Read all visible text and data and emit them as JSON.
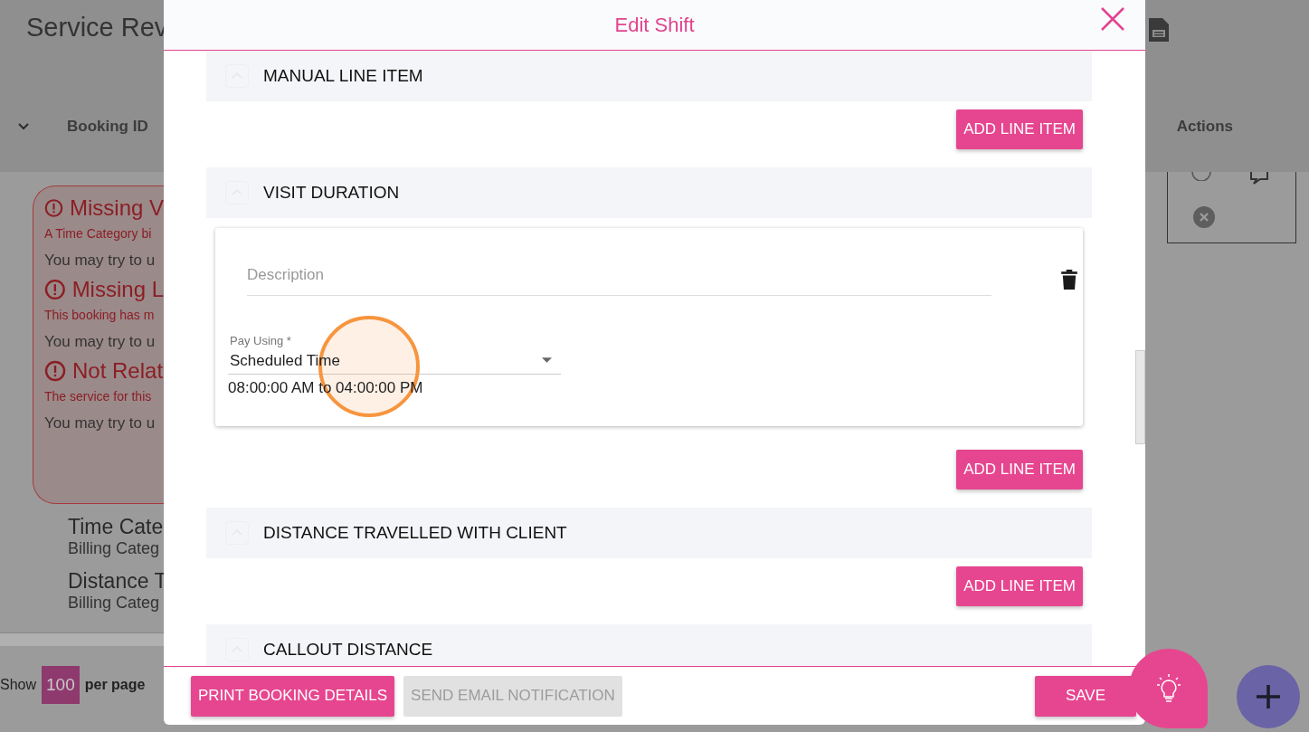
{
  "page": {
    "title": "Service Rev",
    "columns": [
      "Booking ID",
      "Actions"
    ],
    "alerts": [
      {
        "title": "Missing V",
        "detail": "A Time Category bi",
        "hint": "You may try to u"
      },
      {
        "title": "Missing L",
        "detail": "This booking has m",
        "hint": "You may try to u"
      },
      {
        "title": "Not Relat",
        "detail": "The service for this",
        "hint": "You may try to u"
      }
    ],
    "line_items": [
      {
        "name": "Time Cate",
        "category": "Billing Categ"
      },
      {
        "name": "Distance T",
        "category": "Billing Categ"
      }
    ],
    "pagination": {
      "show": "Show",
      "page_size": "100",
      "per_page": "per page"
    }
  },
  "modal": {
    "title": "Edit Shift",
    "sections": [
      {
        "title": "MANUAL LINE ITEM",
        "button": "ADD LINE ITEM"
      },
      {
        "title": "VISIT DURATION",
        "line": {
          "description": {
            "placeholder": "Description"
          },
          "pay_using": {
            "label": "Pay Using *",
            "value": "Scheduled Time"
          },
          "time_range": "08:00:00 AM to 04:00:00 PM"
        },
        "button": "ADD LINE ITEM"
      },
      {
        "title": "DISTANCE TRAVELLED WITH CLIENT",
        "button": "ADD LINE ITEM"
      },
      {
        "title": "CALLOUT DISTANCE"
      }
    ],
    "footer_left_buttons": [
      {
        "label": "PRINT BOOKING DETAILS",
        "disabled": false
      },
      {
        "label": "SEND EMAIL NOTIFICATION",
        "disabled": true
      }
    ],
    "footer_right_buttons": [
      {
        "label": "SAVE",
        "disabled": false
      }
    ]
  }
}
